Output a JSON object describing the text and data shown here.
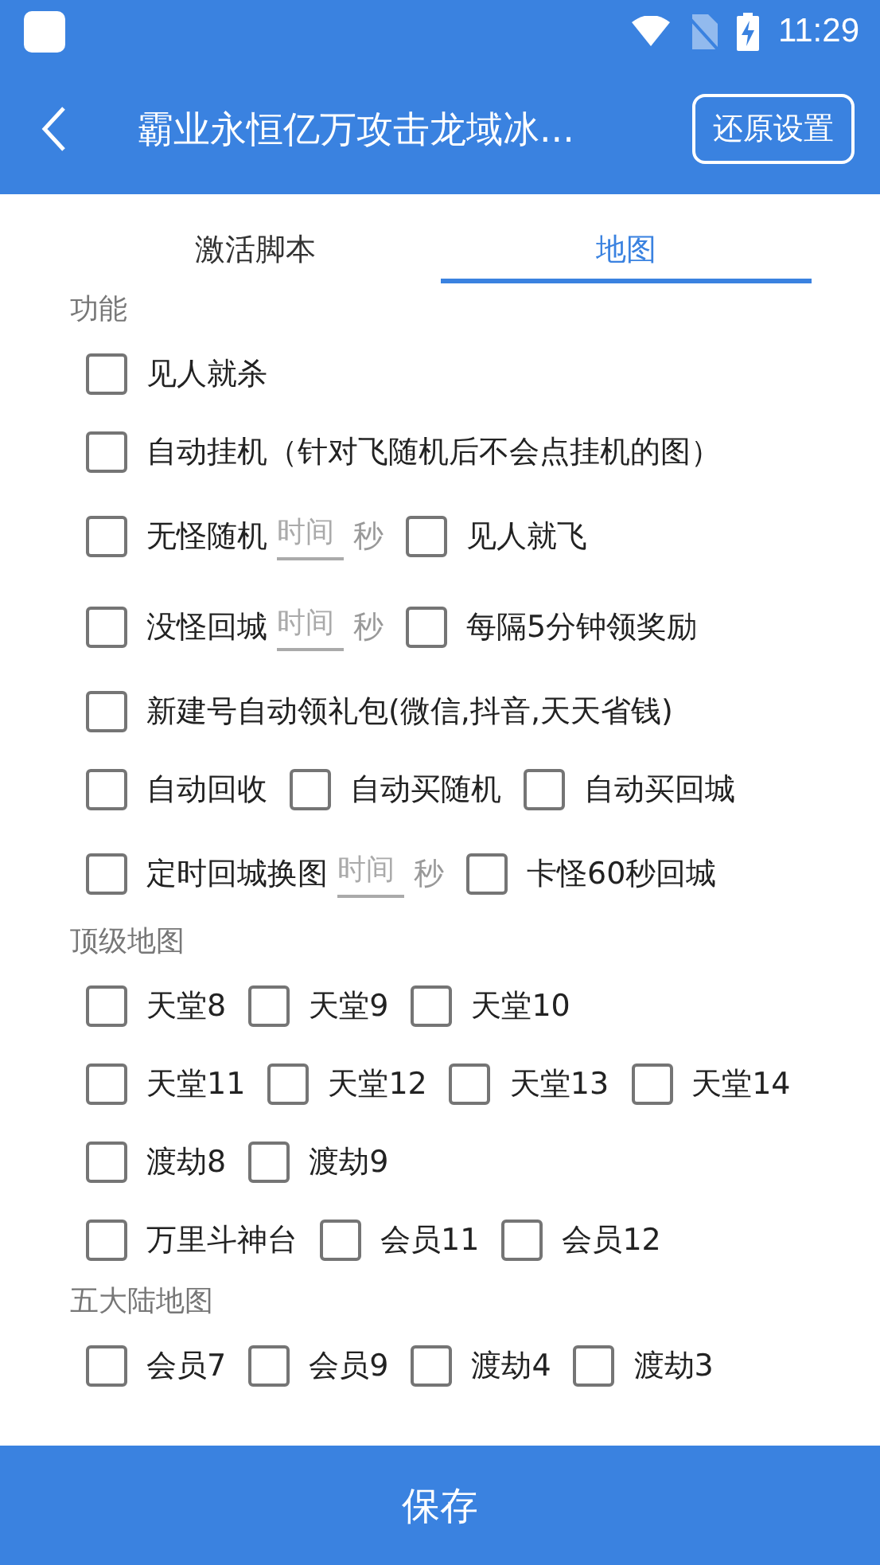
{
  "status_bar": {
    "time": "11:29"
  },
  "toolbar": {
    "title": "霸业永恒亿万攻击龙域冰...",
    "reset_button": "还原设置"
  },
  "tabs": [
    {
      "label": "激活脚本",
      "selected": false
    },
    {
      "label": "地图",
      "selected": true
    }
  ],
  "sections": [
    {
      "title": "功能",
      "rows": [
        [
          {
            "kind": "checkbox",
            "label": "见人就杀",
            "checked": false
          }
        ],
        [
          {
            "kind": "checkbox",
            "label": "自动挂机（针对飞随机后不会点挂机的图）",
            "checked": false
          }
        ],
        [
          {
            "kind": "checkbox",
            "label": "无怪随机",
            "checked": false
          },
          {
            "kind": "time",
            "placeholder": "时间",
            "unit": "秒"
          },
          {
            "kind": "checkbox",
            "label": "见人就飞",
            "checked": false
          }
        ],
        [
          {
            "kind": "checkbox",
            "label": "没怪回城",
            "checked": false
          },
          {
            "kind": "time",
            "placeholder": "时间",
            "unit": "秒"
          },
          {
            "kind": "checkbox",
            "label": "每隔5分钟领奖励",
            "checked": false
          }
        ],
        [
          {
            "kind": "checkbox",
            "label": "新建号自动领礼包(微信,抖音,天天省钱)",
            "checked": false
          }
        ],
        [
          {
            "kind": "checkbox",
            "label": "自动回收",
            "checked": false
          },
          {
            "kind": "checkbox",
            "label": "自动买随机",
            "checked": false
          },
          {
            "kind": "checkbox",
            "label": "自动买回城",
            "checked": false
          }
        ],
        [
          {
            "kind": "checkbox",
            "label": "定时回城换图",
            "checked": false
          },
          {
            "kind": "time",
            "placeholder": "时间",
            "unit": "秒"
          },
          {
            "kind": "checkbox",
            "label": "卡怪60秒回城",
            "checked": false
          }
        ]
      ]
    },
    {
      "title": "顶级地图",
      "rows": [
        [
          {
            "kind": "checkbox",
            "label": "天堂8",
            "checked": false
          },
          {
            "kind": "checkbox",
            "label": "天堂9",
            "checked": false
          },
          {
            "kind": "checkbox",
            "label": "天堂10",
            "checked": false
          }
        ],
        [
          {
            "kind": "checkbox",
            "label": "天堂11",
            "checked": false
          },
          {
            "kind": "checkbox",
            "label": "天堂12",
            "checked": false
          },
          {
            "kind": "checkbox",
            "label": "天堂13",
            "checked": false
          },
          {
            "kind": "checkbox",
            "label": "天堂14",
            "checked": false
          }
        ],
        [
          {
            "kind": "checkbox",
            "label": "渡劫8",
            "checked": false
          },
          {
            "kind": "checkbox",
            "label": "渡劫9",
            "checked": false
          }
        ],
        [
          {
            "kind": "checkbox",
            "label": "万里斗神台",
            "checked": false
          },
          {
            "kind": "checkbox",
            "label": "会员11",
            "checked": false
          },
          {
            "kind": "checkbox",
            "label": "会员12",
            "checked": false
          }
        ]
      ]
    },
    {
      "title": "五大陆地图",
      "rows": [
        [
          {
            "kind": "checkbox",
            "label": "会员7",
            "checked": false
          },
          {
            "kind": "checkbox",
            "label": "会员9",
            "checked": false
          },
          {
            "kind": "checkbox",
            "label": "渡劫4",
            "checked": false
          },
          {
            "kind": "checkbox",
            "label": "渡劫3",
            "checked": false
          }
        ]
      ]
    }
  ],
  "save_button": "保存"
}
